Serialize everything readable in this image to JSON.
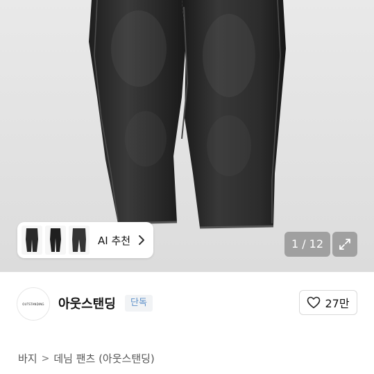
{
  "gallery": {
    "ai_label": "AI 추천",
    "pager": "1 / 12"
  },
  "brand": {
    "logo_text": "OUTSTANDING",
    "name": "아웃스탠딩",
    "badge": "단독",
    "likes": "27만"
  },
  "breadcrumb": {
    "category": "바지",
    "separator": ">",
    "item": "데님 팬츠 (아웃스탠딩)"
  },
  "colors": {
    "denim": "#2b2b2b",
    "badge_text": "#5b8fc9",
    "background": "#e4e4e4"
  },
  "icons": {
    "ai_chevron": "chevron-right-icon",
    "expand": "expand-arrows-icon",
    "like": "heart-outline-icon"
  }
}
